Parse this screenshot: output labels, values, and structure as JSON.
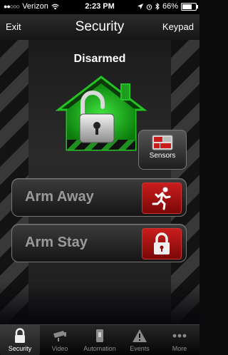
{
  "status_bar": {
    "carrier": "Verizon",
    "time": "2:23 PM",
    "battery": "66%"
  },
  "nav": {
    "left_label": "Exit",
    "title": "Security",
    "right_label": "Keypad"
  },
  "main": {
    "status_text": "Disarmed",
    "sensors_label": "Sensors",
    "arm_away_label": "Arm Away",
    "arm_stay_label": "Arm Stay"
  },
  "tabs": [
    {
      "label": "Security",
      "icon": "lock-icon",
      "active": true
    },
    {
      "label": "Video",
      "icon": "camera-icon",
      "active": false
    },
    {
      "label": "Automation",
      "icon": "switch-icon",
      "active": false
    },
    {
      "label": "Events",
      "icon": "warning-icon",
      "active": false
    },
    {
      "label": "More",
      "icon": "more-icon",
      "active": false
    }
  ],
  "colors": {
    "house_green": "#22c322",
    "arm_red": "#c91d1d"
  }
}
